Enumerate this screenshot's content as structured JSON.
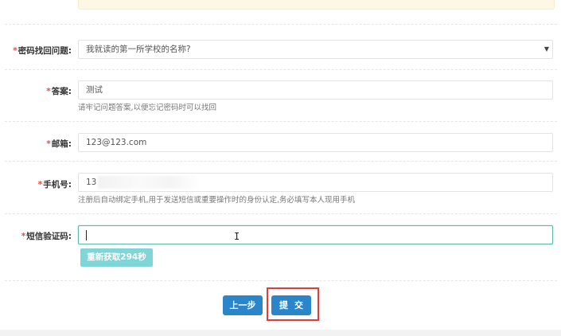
{
  "form": {
    "security_question": {
      "label": "密码找回问题:",
      "value": "我就读的第一所学校的名称?",
      "caret": "▼"
    },
    "answer": {
      "label": "答案:",
      "value": "测试",
      "help": "请牢记问题答案,以便忘记密码时可以找回"
    },
    "email": {
      "label": "邮箱:",
      "value": "123@123.com"
    },
    "phone": {
      "label": "手机号:",
      "value_visible": "13",
      "help": "注册后自动绑定手机,用于发送短信或重要操作时的身份认定,务必填写本人现用手机"
    },
    "sms_code": {
      "label": "短信验证码:",
      "value": "",
      "resend_label": "重新获取294秒"
    },
    "required_mark": "*"
  },
  "actions": {
    "prev_label": "上一步",
    "submit_label": "提交"
  },
  "colors": {
    "primary": "#2a86c8",
    "resend": "#7ed6d6",
    "required": "#d9534f",
    "highlight": "#e43a3a",
    "active_border": "#5cb8a8"
  }
}
